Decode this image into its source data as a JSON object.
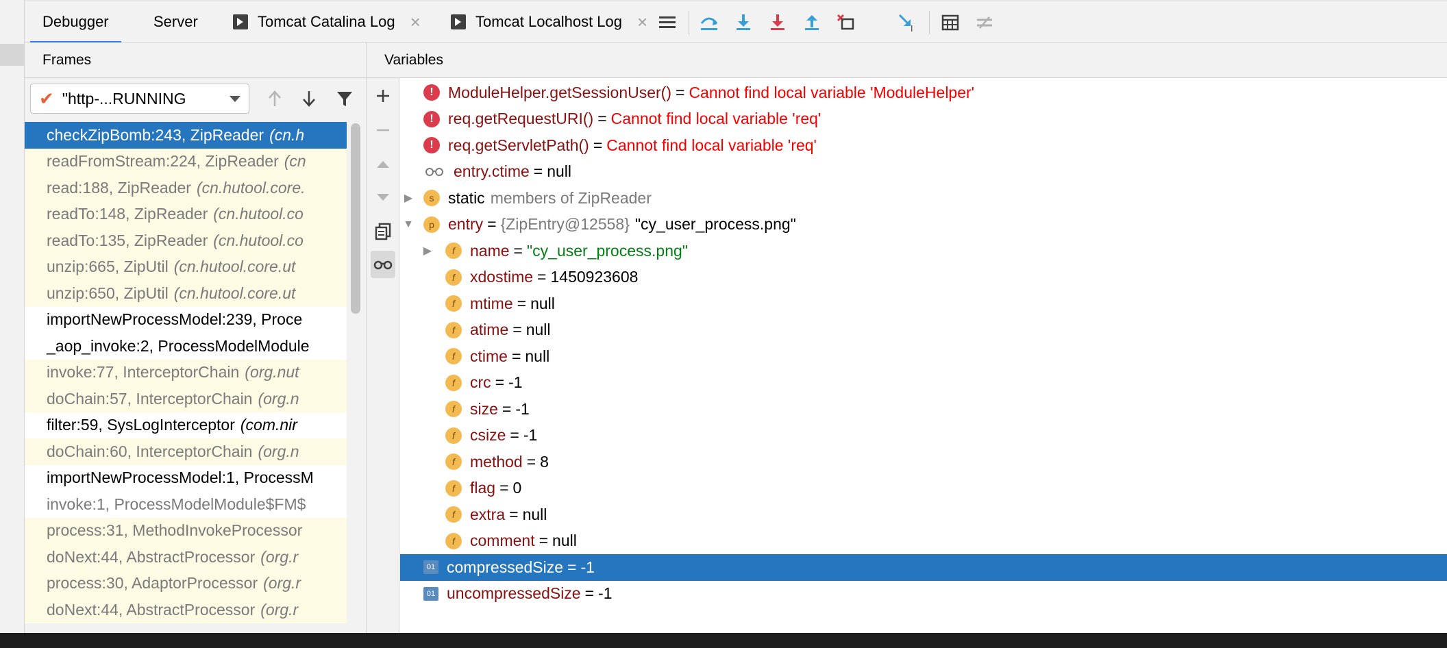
{
  "tabs": [
    {
      "label": "Debugger",
      "active": true
    },
    {
      "label": "Server",
      "active": false
    },
    {
      "label": "Tomcat Catalina Log",
      "closable": true
    },
    {
      "label": "Tomcat Localhost Log",
      "closable": true
    }
  ],
  "toolbar_icons": [
    "threads-icon",
    "step-over-icon",
    "step-into-icon",
    "force-step-into-icon",
    "step-out-icon",
    "drop-frame-icon",
    "run-to-cursor-icon",
    "evaluate-expression-icon",
    "trace-icon"
  ],
  "frames": {
    "title": "Frames",
    "thread": "\"http-...RUNNING",
    "rows": [
      {
        "method": "checkZipBomb:243, ZipReader",
        "pkg": "(cn.h",
        "kind": "selected"
      },
      {
        "method": "readFromStream:224, ZipReader",
        "pkg": "(cn",
        "kind": "lib"
      },
      {
        "method": "read:188, ZipReader",
        "pkg": "(cn.hutool.core.",
        "kind": "lib"
      },
      {
        "method": "readTo:148, ZipReader",
        "pkg": "(cn.hutool.co",
        "kind": "lib"
      },
      {
        "method": "readTo:135, ZipReader",
        "pkg": "(cn.hutool.co",
        "kind": "lib"
      },
      {
        "method": "unzip:665, ZipUtil",
        "pkg": "(cn.hutool.core.ut",
        "kind": "lib"
      },
      {
        "method": "unzip:650, ZipUtil",
        "pkg": "(cn.hutool.core.ut",
        "kind": "lib"
      },
      {
        "method": "importNewProcessModel:239, Proce",
        "pkg": "",
        "kind": "app"
      },
      {
        "method": "_aop_invoke:2, ProcessModelModule",
        "pkg": "",
        "kind": "app"
      },
      {
        "method": "invoke:77, InterceptorChain",
        "pkg": "(org.nut",
        "kind": "lib"
      },
      {
        "method": "doChain:57, InterceptorChain",
        "pkg": "(org.n",
        "kind": "lib"
      },
      {
        "method": "filter:59, SysLogInterceptor",
        "pkg": "(com.nir",
        "kind": "app"
      },
      {
        "method": "doChain:60, InterceptorChain",
        "pkg": "(org.n",
        "kind": "lib"
      },
      {
        "method": "importNewProcessModel:1, ProcessM",
        "pkg": "",
        "kind": "app"
      },
      {
        "method": "invoke:1, ProcessModelModule$FM$",
        "pkg": "",
        "kind": "app-gray"
      },
      {
        "method": "process:31, MethodInvokeProcessor",
        "pkg": "",
        "kind": "lib"
      },
      {
        "method": "doNext:44, AbstractProcessor",
        "pkg": "(org.r",
        "kind": "lib"
      },
      {
        "method": "process:30, AdaptorProcessor",
        "pkg": "(org.r",
        "kind": "lib"
      },
      {
        "method": "doNext:44, AbstractProcessor",
        "pkg": "(org.r",
        "kind": "lib"
      }
    ]
  },
  "variables": {
    "title": "Variables",
    "rows": [
      {
        "icon": "error",
        "name": "ModuleHelper.getSessionUser()",
        "value": "Cannot find local variable 'ModuleHelper'",
        "vtype": "err",
        "indent": 0
      },
      {
        "icon": "error",
        "name": "req.getRequestURI()",
        "value": "Cannot find local variable 'req'",
        "vtype": "err",
        "indent": 0
      },
      {
        "icon": "error",
        "name": "req.getServletPath()",
        "value": "Cannot find local variable 'req'",
        "vtype": "err",
        "indent": 0
      },
      {
        "icon": "watch",
        "name": "entry.ctime",
        "value": "null",
        "vtype": "plain",
        "indent": 0
      },
      {
        "icon": "static",
        "name": "static",
        "value": "members of ZipReader",
        "vtype": "static",
        "indent": 0,
        "expander": "right"
      },
      {
        "icon": "param",
        "name": "entry",
        "value": "\"cy_user_process.png\"",
        "ref": "{ZipEntry@12558}",
        "vtype": "ref",
        "indent": 0,
        "expander": "down"
      },
      {
        "icon": "field",
        "name": "name",
        "value": "\"cy_user_process.png\"",
        "vtype": "str",
        "indent": 1,
        "expander": "right"
      },
      {
        "icon": "field",
        "name": "xdostime",
        "value": "1450923608",
        "vtype": "plain",
        "indent": 1
      },
      {
        "icon": "field",
        "name": "mtime",
        "value": "null",
        "vtype": "plain",
        "indent": 1
      },
      {
        "icon": "field",
        "name": "atime",
        "value": "null",
        "vtype": "plain",
        "indent": 1
      },
      {
        "icon": "field",
        "name": "ctime",
        "value": "null",
        "vtype": "plain",
        "indent": 1
      },
      {
        "icon": "field",
        "name": "crc",
        "value": "-1",
        "vtype": "plain",
        "indent": 1
      },
      {
        "icon": "field",
        "name": "size",
        "value": "-1",
        "vtype": "plain",
        "indent": 1
      },
      {
        "icon": "field",
        "name": "csize",
        "value": "-1",
        "vtype": "plain",
        "indent": 1
      },
      {
        "icon": "field",
        "name": "method",
        "value": "8",
        "vtype": "plain",
        "indent": 1
      },
      {
        "icon": "field",
        "name": "flag",
        "value": "0",
        "vtype": "plain",
        "indent": 1
      },
      {
        "icon": "field",
        "name": "extra",
        "value": "null",
        "vtype": "plain",
        "indent": 1
      },
      {
        "icon": "field",
        "name": "comment",
        "value": "null",
        "vtype": "plain",
        "indent": 1
      },
      {
        "icon": "num",
        "name": "compressedSize",
        "value": "-1",
        "vtype": "plain",
        "indent": 0,
        "selected": true
      },
      {
        "icon": "num",
        "name": "uncompressedSize",
        "value": "-1",
        "vtype": "plain",
        "indent": 0
      }
    ]
  },
  "colors": {
    "accent": "#2675bf",
    "error": "#f50000",
    "string": "#067d17",
    "field_icon": "#f4ba52"
  }
}
